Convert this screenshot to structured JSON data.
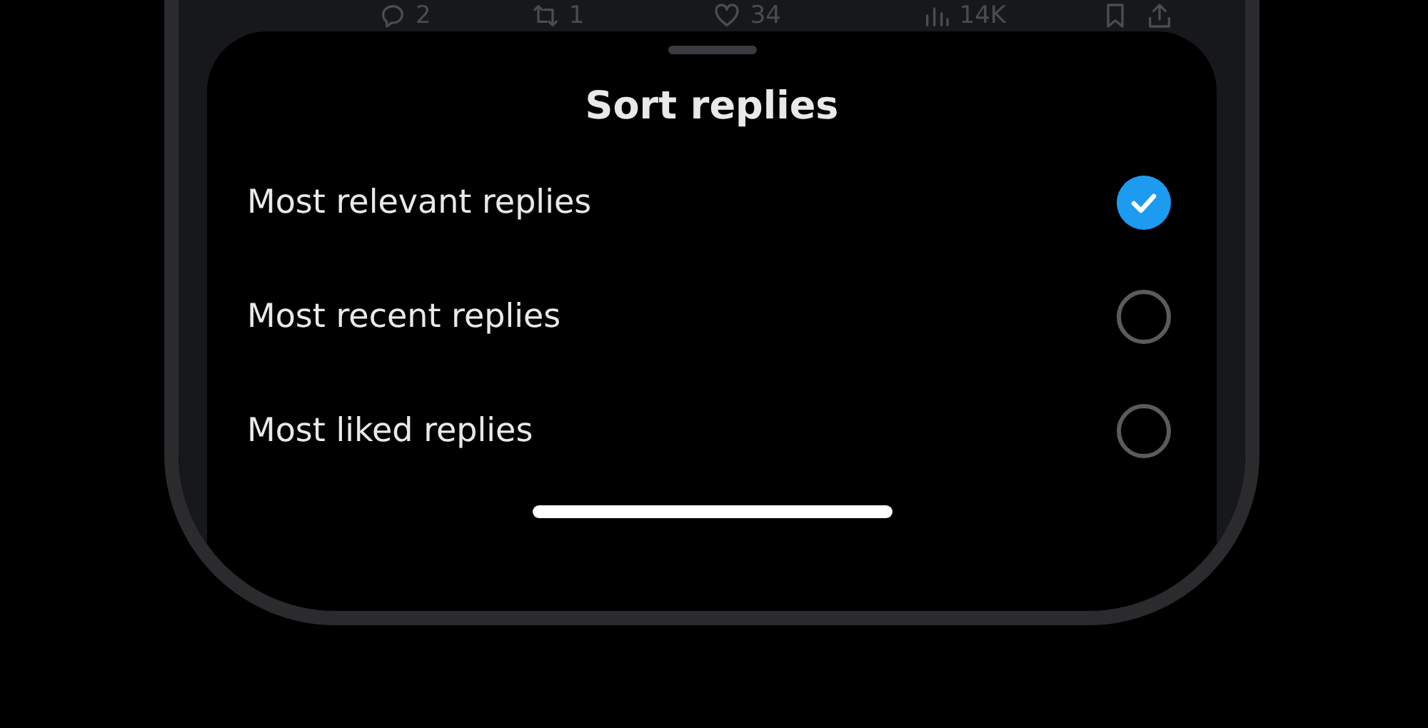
{
  "tweet_actions": [
    {
      "kind": "reply",
      "count": "2"
    },
    {
      "kind": "repost",
      "count": "1"
    },
    {
      "kind": "like",
      "count": "34"
    },
    {
      "kind": "views",
      "count": "14K"
    },
    {
      "kind": "bookmark"
    },
    {
      "kind": "share"
    }
  ],
  "sheet": {
    "title": "Sort replies",
    "options": [
      {
        "label": "Most relevant replies",
        "selected": true
      },
      {
        "label": "Most recent replies",
        "selected": false
      },
      {
        "label": "Most liked replies",
        "selected": false
      }
    ]
  }
}
